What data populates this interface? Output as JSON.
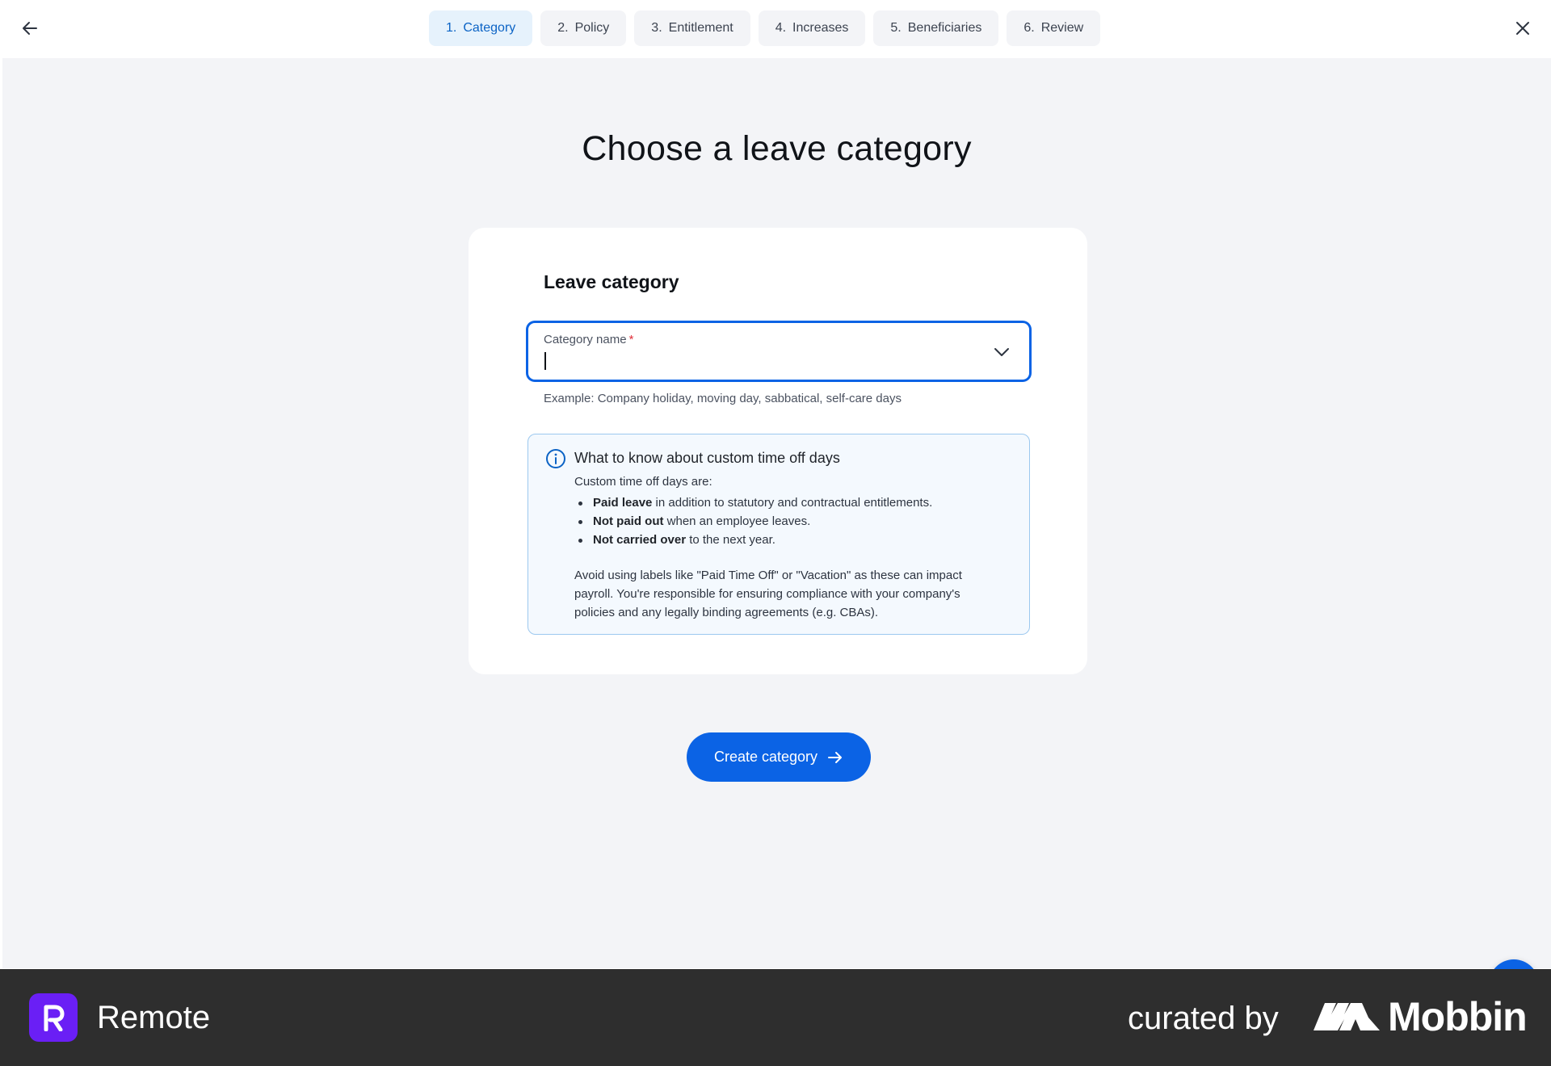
{
  "header": {
    "back_icon": "arrow-left-icon",
    "close_icon": "close-icon",
    "steps": [
      {
        "num": "1.",
        "label": "Category",
        "active": true
      },
      {
        "num": "2.",
        "label": "Policy",
        "active": false
      },
      {
        "num": "3.",
        "label": "Entitlement",
        "active": false
      },
      {
        "num": "4.",
        "label": "Increases",
        "active": false
      },
      {
        "num": "5.",
        "label": "Beneficiaries",
        "active": false
      },
      {
        "num": "6.",
        "label": "Review",
        "active": false
      }
    ]
  },
  "main": {
    "title": "Choose a leave category",
    "card": {
      "title": "Leave category",
      "field": {
        "label": "Category name",
        "required_mark": "*",
        "value": "",
        "helper": "Example: Company holiday, moving day, sabbatical, self-care days"
      },
      "info": {
        "title": "What to know about custom time off days",
        "intro": "Custom time off days are:",
        "items": [
          {
            "bold": "Paid leave",
            "rest": " in addition to statutory and contractual entitlements."
          },
          {
            "bold": "Not paid out",
            "rest": " when an employee leaves."
          },
          {
            "bold": "Not carried over",
            "rest": " to the next year."
          }
        ],
        "note": "Avoid using labels like \"Paid Time Off\" or \"Vacation\" as these can impact payroll. You're responsible for ensuring compliance with your company's policies and any legally binding agreements (e.g. CBAs)."
      }
    },
    "primary_button": "Create category"
  },
  "footer": {
    "brand": "Remote",
    "curated_by": "curated by",
    "mobbin": "Mobbin"
  },
  "colors": {
    "accent": "#0b63e5",
    "active_step_bg": "#e6f2fc",
    "page_bg": "#f3f4f7",
    "info_border": "#9cc8ef",
    "remote_purple": "#6a1ff5",
    "footer_bg": "#2e2e2e"
  }
}
